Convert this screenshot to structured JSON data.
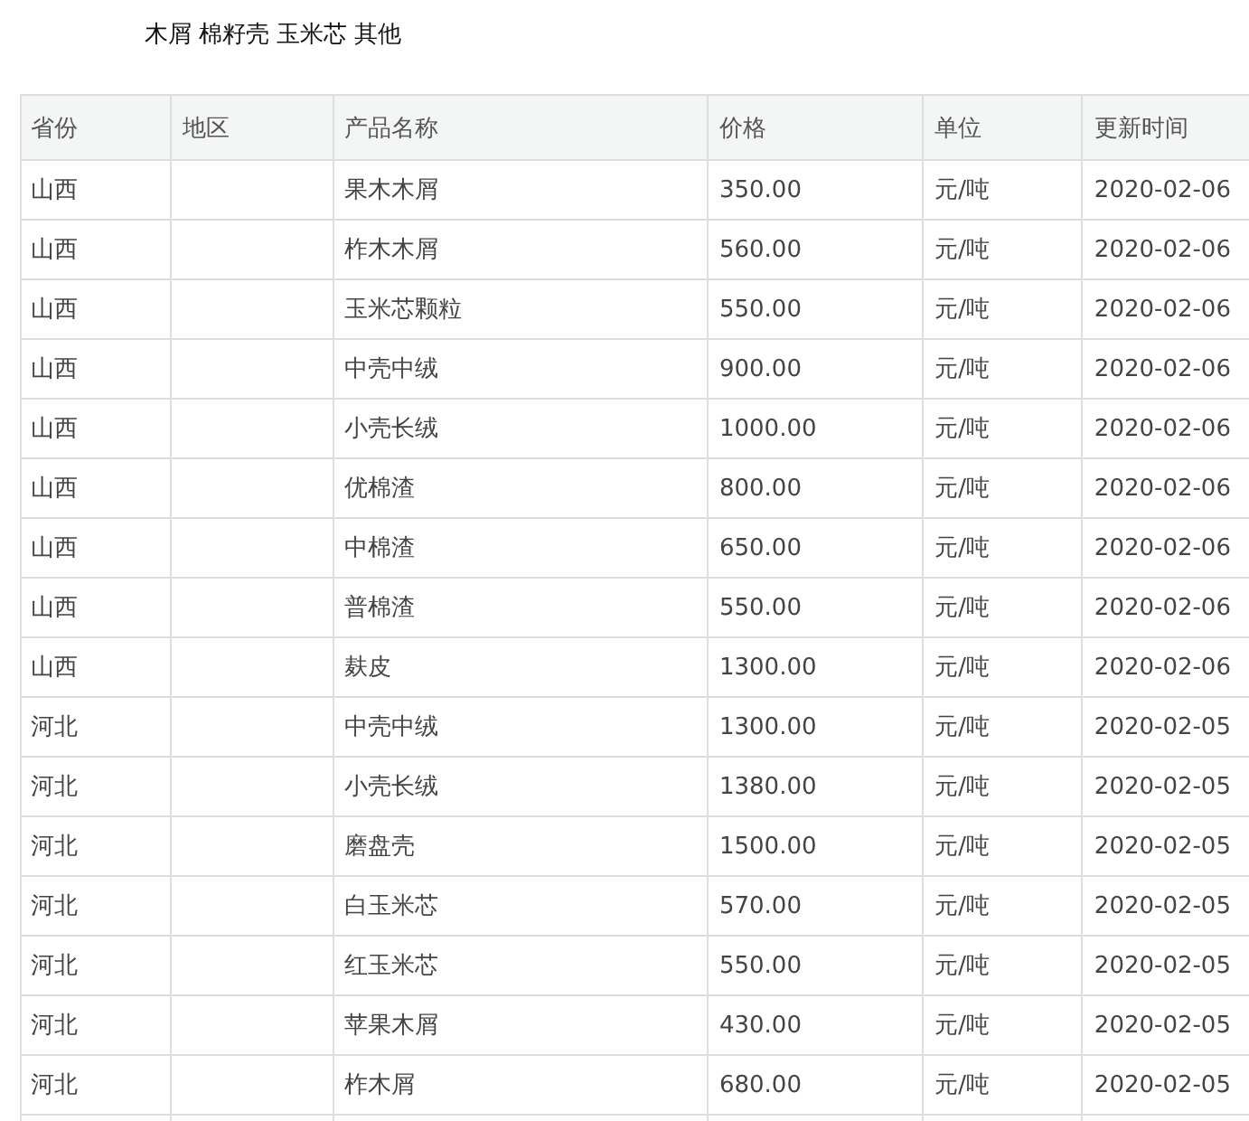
{
  "categories": [
    "木屑",
    "棉籽壳",
    "玉米芯",
    "其他"
  ],
  "table": {
    "columns": [
      "省份",
      "地区",
      "产品名称",
      "价格",
      "单位",
      "更新时间"
    ],
    "rows": [
      [
        "山西",
        "",
        "果木木屑",
        "350.00",
        "元/吨",
        "2020-02-06"
      ],
      [
        "山西",
        "",
        "柞木木屑",
        "560.00",
        "元/吨",
        "2020-02-06"
      ],
      [
        "山西",
        "",
        "玉米芯颗粒",
        "550.00",
        "元/吨",
        "2020-02-06"
      ],
      [
        "山西",
        "",
        "中壳中绒",
        "900.00",
        "元/吨",
        "2020-02-06"
      ],
      [
        "山西",
        "",
        "小壳长绒",
        "1000.00",
        "元/吨",
        "2020-02-06"
      ],
      [
        "山西",
        "",
        "优棉渣",
        "800.00",
        "元/吨",
        "2020-02-06"
      ],
      [
        "山西",
        "",
        "中棉渣",
        "650.00",
        "元/吨",
        "2020-02-06"
      ],
      [
        "山西",
        "",
        "普棉渣",
        "550.00",
        "元/吨",
        "2020-02-06"
      ],
      [
        "山西",
        "",
        "麸皮",
        "1300.00",
        "元/吨",
        "2020-02-06"
      ],
      [
        "河北",
        "",
        "中壳中绒",
        "1300.00",
        "元/吨",
        "2020-02-05"
      ],
      [
        "河北",
        "",
        "小壳长绒",
        "1380.00",
        "元/吨",
        "2020-02-05"
      ],
      [
        "河北",
        "",
        "磨盘壳",
        "1500.00",
        "元/吨",
        "2020-02-05"
      ],
      [
        "河北",
        "",
        "白玉米芯",
        "570.00",
        "元/吨",
        "2020-02-05"
      ],
      [
        "河北",
        "",
        "红玉米芯",
        "550.00",
        "元/吨",
        "2020-02-05"
      ],
      [
        "河北",
        "",
        "苹果木屑",
        "430.00",
        "元/吨",
        "2020-02-05"
      ],
      [
        "河北",
        "",
        "柞木屑",
        "680.00",
        "元/吨",
        "2020-02-05"
      ]
    ]
  }
}
